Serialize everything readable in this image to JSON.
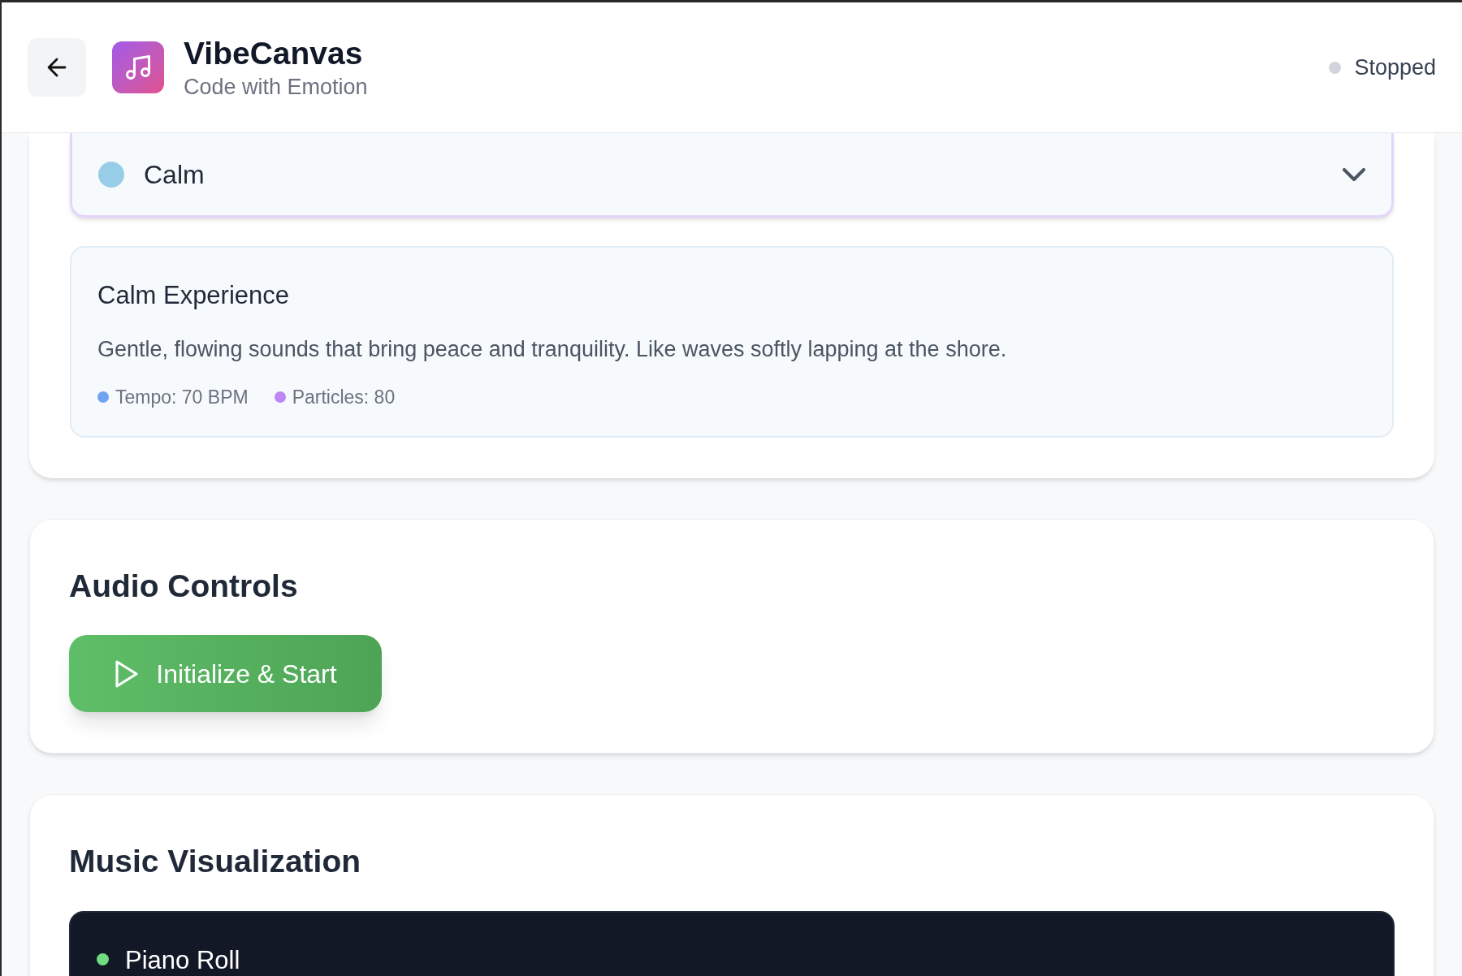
{
  "header": {
    "title": "VibeCanvas",
    "subtitle": "Code with Emotion",
    "status": {
      "label": "Stopped",
      "running": false
    }
  },
  "mood_select": {
    "value": "Calm",
    "color": "#98cde8"
  },
  "mood_info": {
    "title": "Calm Experience",
    "description": "Gentle, flowing sounds that bring peace and tranquility. Like waves softly lapping at the shore.",
    "stats": [
      {
        "label": "Tempo: 70 BPM",
        "color": "#6ea4f2"
      },
      {
        "label": "Particles: 80",
        "color": "#bd88f5"
      }
    ]
  },
  "audio_controls": {
    "title": "Audio Controls",
    "button": {
      "label": "Initialize & Start"
    }
  },
  "visualization": {
    "title": "Music Visualization",
    "panel": {
      "label": "Piano Roll",
      "color": "#6fdc80"
    }
  }
}
